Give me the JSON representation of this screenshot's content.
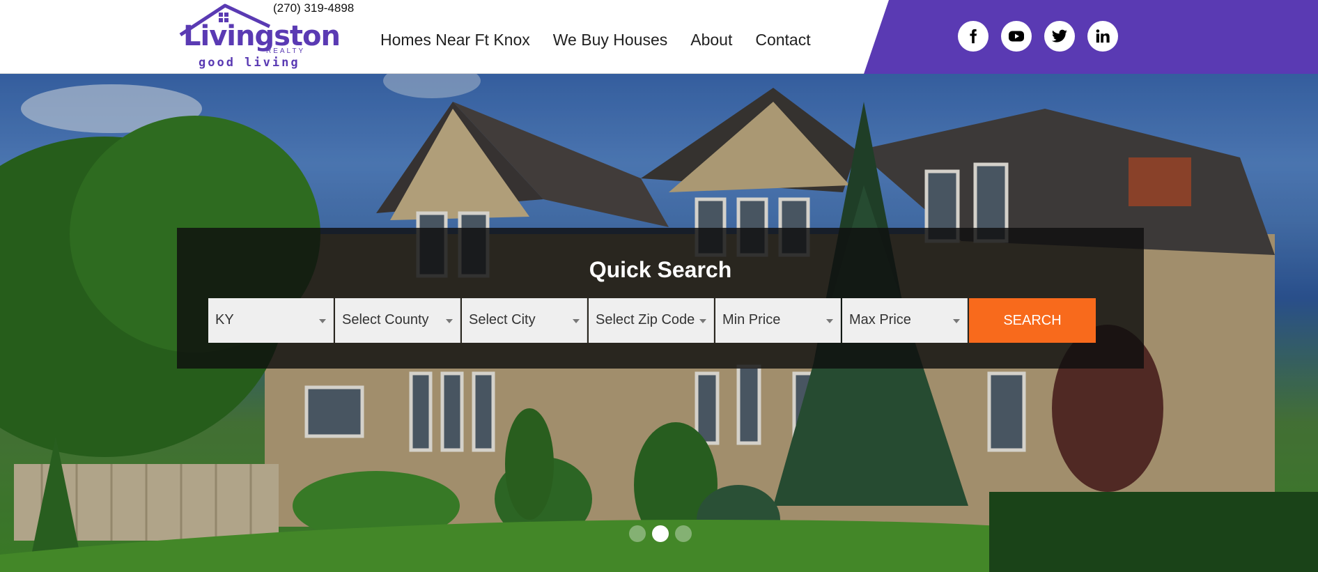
{
  "header": {
    "phone": "(270) 319-4898",
    "logo": {
      "name": "Livingston",
      "subtitle": "REALTY",
      "tagline": "good living"
    },
    "nav": [
      {
        "label": "Homes Near Ft Knox"
      },
      {
        "label": "We Buy Houses"
      },
      {
        "label": "About"
      },
      {
        "label": "Contact"
      }
    ],
    "socials": [
      {
        "icon": "facebook-icon"
      },
      {
        "icon": "youtube-icon"
      },
      {
        "icon": "twitter-icon"
      },
      {
        "icon": "linkedin-icon"
      }
    ],
    "accent_color": "#5a3ab3"
  },
  "search": {
    "title": "Quick Search",
    "fields": [
      {
        "value": "KY"
      },
      {
        "value": "Select County"
      },
      {
        "value": "Select City"
      },
      {
        "value": "Select Zip Code"
      },
      {
        "value": "Min Price"
      },
      {
        "value": "Max Price"
      }
    ],
    "button_label": "SEARCH",
    "button_color": "#f86a1c"
  },
  "slider": {
    "slide_count": 3,
    "active_slide": 2
  }
}
